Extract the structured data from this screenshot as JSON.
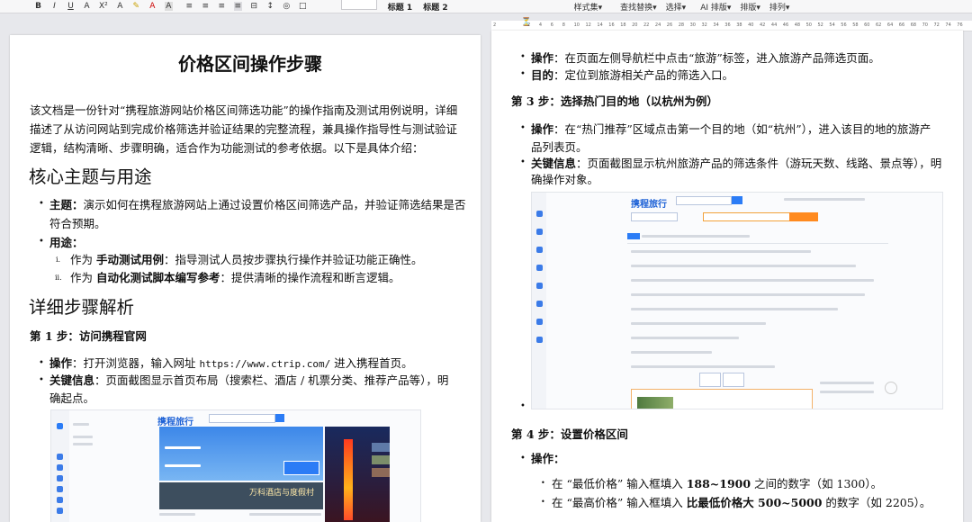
{
  "toolbar": {
    "format_icons": [
      "B",
      "I",
      "U",
      "A",
      "X²",
      "A",
      "✎",
      "A",
      "A"
    ],
    "para_icons": [
      "≡",
      "≡",
      "≡",
      "≡",
      "⊟",
      "↕",
      "◎",
      "□"
    ],
    "styles": [
      "标题 1",
      "标题 2"
    ],
    "menus": [
      "样式集▾",
      "查找替换▾",
      "选择▾",
      "AI 排版▾",
      "排版▾",
      "排列▾"
    ]
  },
  "ruler": {
    "ticks": [
      "2",
      "2",
      "4",
      "6",
      "8",
      "10",
      "12",
      "14",
      "16",
      "18",
      "20",
      "22",
      "24",
      "26",
      "28",
      "30",
      "32",
      "34",
      "36",
      "38",
      "40",
      "42",
      "44",
      "46",
      "48",
      "50",
      "52",
      "54",
      "56",
      "58",
      "60",
      "62",
      "64",
      "66",
      "68",
      "70",
      "72",
      "74",
      "76"
    ]
  },
  "left_page": {
    "title": "价格区间操作步骤",
    "intro_lines": [
      "该文档是一份针对“携程旅游网站价格区间筛选功能”的操作指南及测试用例说明，详细",
      "描述了从访问网站到完成价格筛选并验证结果的完整流程，兼具操作指导性与测试验证",
      "逻辑，结构清晰、步骤明确，适合作为功能测试的参考依据。以下是具体介绍："
    ],
    "h_core": "核心主题与用途",
    "theme_label": "主题：",
    "theme_line1": "演示如何在携程旅游网站上通过设置价格区间筛选产品，并验证筛选结果是否",
    "theme_line2": "符合预期。",
    "use_label": "用途：",
    "use_items": [
      {
        "num": "i.",
        "pre": "作为 ",
        "bold": "手动测试用例",
        "post": "：指导测试人员按步骤执行操作并验证功能正确性。"
      },
      {
        "num": "ii.",
        "pre": "作为 ",
        "bold": "自动化测试脚本编写参考",
        "post": "：提供清晰的操作流程和断言逻辑。"
      }
    ],
    "h_detail": "详细步骤解析",
    "step1": "第 1 步：访问携程官网",
    "op_label": "操作",
    "op_pre": "：打开浏览器，输入网址 ",
    "op_url": "https://www.ctrip.com/",
    "op_post": " 进入携程首页。",
    "key_label": "关键信息",
    "key_line1": "：页面截图显示首页布局（搜索栏、酒店 / 机票分类、推荐产品等），明",
    "key_line2": "确起点。",
    "shot_logo": "携程旅行",
    "shot_banner": "万科酒店与度假村"
  },
  "right_page": {
    "op_label": "操作",
    "op_text": "：在页面左侧导航栏中点击“旅游”标签，进入旅游产品筛选页面。",
    "goal_label": "目的",
    "goal_text": "：定位到旅游相关产品的筛选入口。",
    "step3": "第 3 步：选择热门目的地（以杭州为例）",
    "op3_label": "操作",
    "op3_line1": "：在“热门推荐”区域点击第一个目的地（如“杭州”），进入该目的地的旅游产",
    "op3_line2": "品列表页。",
    "key3_label": "关键信息",
    "key3_line1": "：页面截图显示杭州旅游产品的筛选条件（游玩天数、线路、景点等），明",
    "key3_line2": "确操作对象。",
    "shot_logo": "携程旅行",
    "step4": "第 4 步：设置价格区间",
    "op4_label": "操作：",
    "min_pre": "在 “最低价格” 输入框填入 ",
    "min_bold": "188~1900",
    "min_post": " 之间的数字（如 1300）。",
    "max_pre": "在 “最高价格” 输入框填入 ",
    "max_bold": "比最低价格大 500~5000",
    "max_post": " 的数字（如 2205）。"
  }
}
